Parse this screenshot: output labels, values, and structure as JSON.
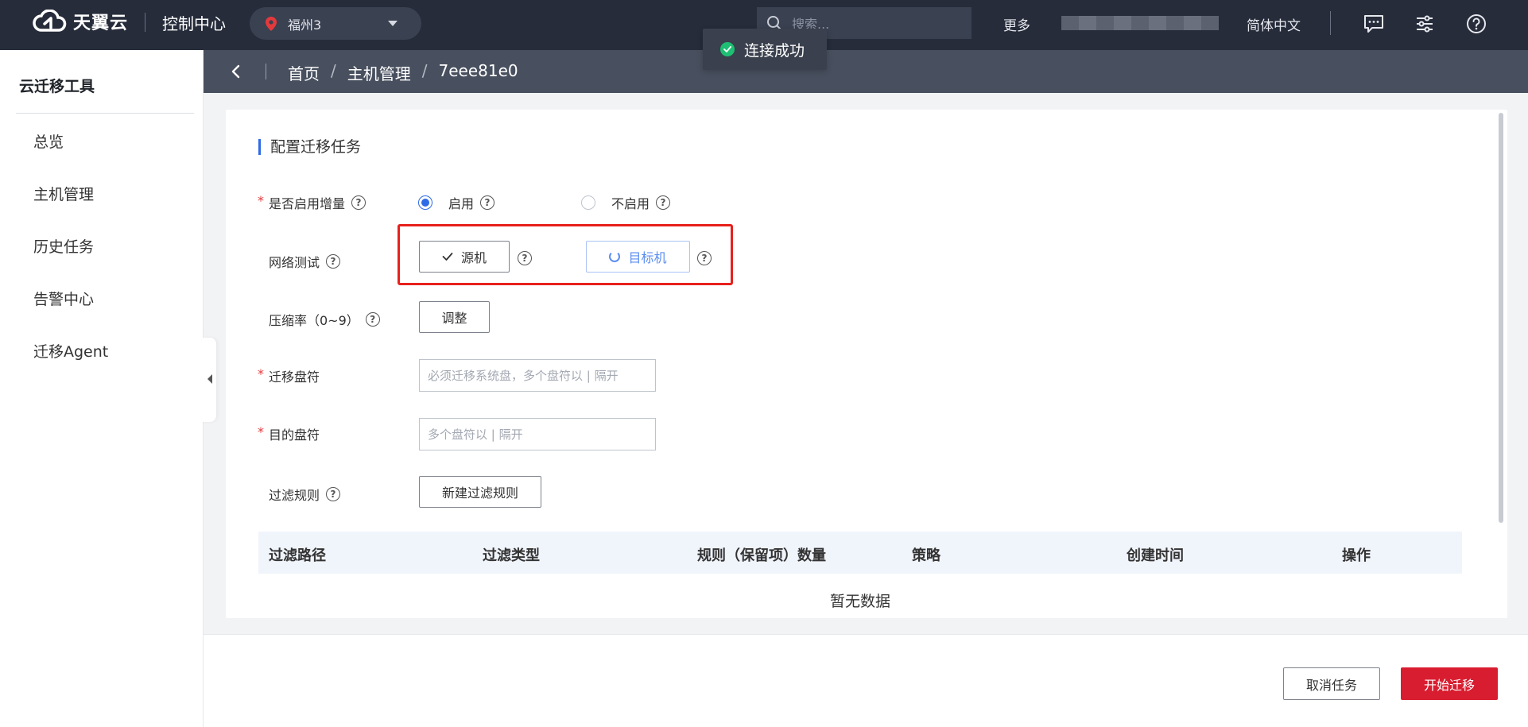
{
  "topbar": {
    "brand": "天翼云",
    "console": "控制中心",
    "region": "福州3",
    "search_placeholder": "搜索...",
    "more": "更多",
    "language": "简体中文",
    "icons": [
      "message-icon",
      "sliders-icon",
      "help-icon"
    ]
  },
  "sidebar": {
    "title": "云迁移工具",
    "items": [
      {
        "label": "总览"
      },
      {
        "label": "主机管理"
      },
      {
        "label": "历史任务"
      },
      {
        "label": "告警中心"
      },
      {
        "label": "迁移Agent"
      }
    ]
  },
  "breadcrumb": {
    "items": [
      "首页",
      "主机管理",
      "7eee81e0"
    ]
  },
  "toast": {
    "message": "连接成功"
  },
  "form": {
    "section_title": "配置迁移任务",
    "incremental": {
      "label": "是否启用增量",
      "options": [
        "启用",
        "不启用"
      ],
      "selected": "启用"
    },
    "network_test": {
      "label": "网络测试",
      "source_button": "源机",
      "target_button": "目标机"
    },
    "compression": {
      "label": "压缩率（0~9）",
      "button": "调整"
    },
    "migrate_drive": {
      "label": "迁移盘符",
      "placeholder": "必须迁移系统盘，多个盘符以 | 隔开"
    },
    "dest_drive": {
      "label": "目的盘符",
      "placeholder": "多个盘符以 | 隔开"
    },
    "filter_rules": {
      "label": "过滤规则",
      "button": "新建过滤规则"
    }
  },
  "table": {
    "columns": [
      "过滤路径",
      "过滤类型",
      "规则（保留项）数量",
      "策略",
      "创建时间",
      "操作"
    ],
    "empty_text": "暂无数据"
  },
  "footer": {
    "cancel": "取消任务",
    "start": "开始迁移"
  },
  "colors": {
    "accent": "#2e6be6",
    "danger": "#d91d30",
    "success": "#1dbf73",
    "highlight": "#e8201c"
  }
}
